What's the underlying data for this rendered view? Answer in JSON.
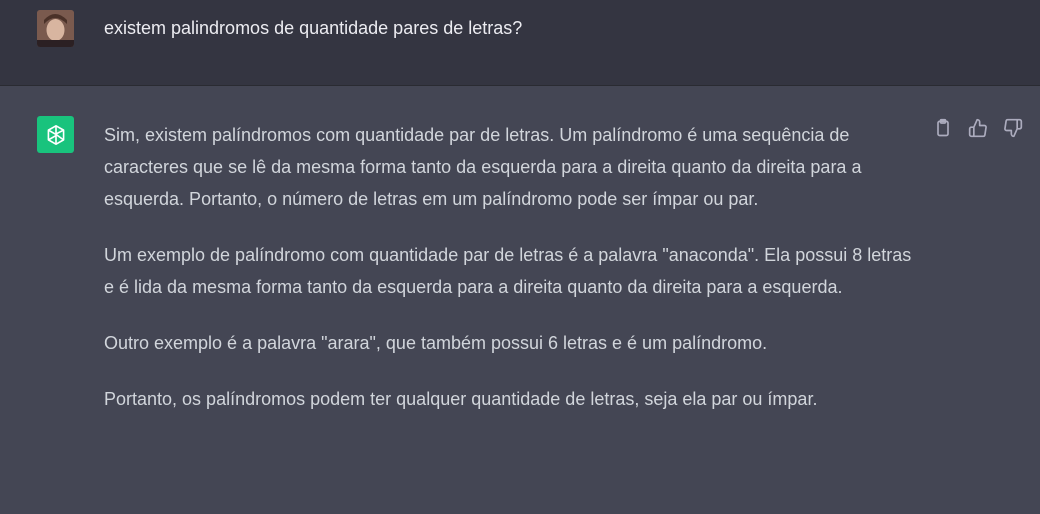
{
  "user_message": {
    "text": "existem palindromos de quantidade pares de letras?"
  },
  "assistant_message": {
    "paragraphs": [
      "Sim, existem palíndromos com quantidade par de letras. Um palíndromo é uma sequência de caracteres que se lê da mesma forma tanto da esquerda para a direita quanto da direita para a esquerda. Portanto, o número de letras em um palíndromo pode ser ímpar ou par.",
      "Um exemplo de palíndromo com quantidade par de letras é a palavra \"anaconda\". Ela possui 8 letras e é lida da mesma forma tanto da esquerda para a direita quanto da direita para a esquerda.",
      "Outro exemplo é a palavra \"arara\", que também possui 6 letras e é um palíndromo.",
      "Portanto, os palíndromos podem ter qualquer quantidade de letras, seja ela par ou ímpar."
    ]
  },
  "icons": {
    "user_avatar": "user-avatar",
    "bot_avatar": "openai-logo-icon",
    "actions": [
      "clipboard-icon",
      "thumbs-up-icon",
      "thumbs-down-icon"
    ]
  },
  "colors": {
    "user_bg": "#343541",
    "assistant_bg": "#444654",
    "bot_avatar_bg": "#19c37d",
    "text": "#d1d5db"
  }
}
